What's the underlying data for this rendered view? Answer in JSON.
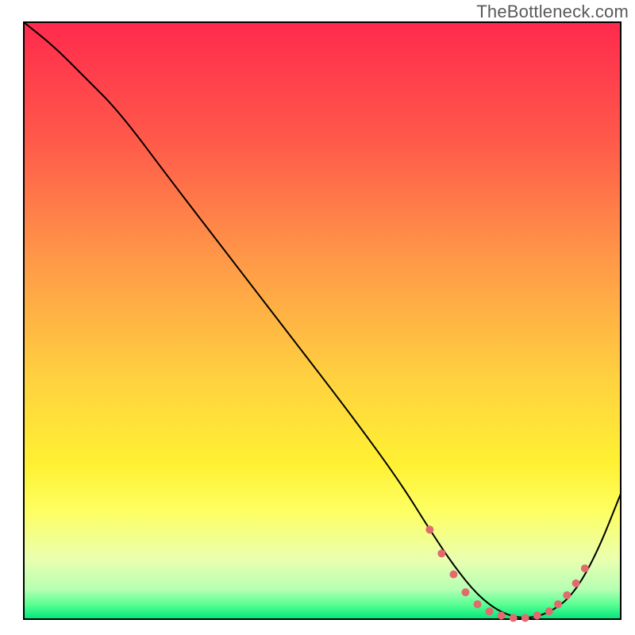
{
  "watermark": "TheBottleneck.com",
  "chart_data": {
    "type": "line",
    "title": "",
    "xlabel": "",
    "ylabel": "",
    "xlim": [
      0,
      100
    ],
    "ylim": [
      0,
      100
    ],
    "grid": false,
    "legend": false,
    "background": {
      "type": "vertical-gradient",
      "stops": [
        {
          "pos": 0.0,
          "color": "#ff2a4d"
        },
        {
          "pos": 0.2,
          "color": "#ff5a4a"
        },
        {
          "pos": 0.4,
          "color": "#ff9948"
        },
        {
          "pos": 0.6,
          "color": "#ffd23f"
        },
        {
          "pos": 0.74,
          "color": "#fff133"
        },
        {
          "pos": 0.82,
          "color": "#fdff62"
        },
        {
          "pos": 0.9,
          "color": "#eaffb0"
        },
        {
          "pos": 0.95,
          "color": "#b6ffb3"
        },
        {
          "pos": 0.975,
          "color": "#5cff93"
        },
        {
          "pos": 1.0,
          "color": "#00e67c"
        }
      ]
    },
    "series": [
      {
        "name": "bottleneck-curve",
        "color": "#000000",
        "stroke_width": 2,
        "x": [
          0,
          5,
          10,
          16,
          25,
          35,
          45,
          55,
          63,
          68,
          72,
          76,
          80,
          84,
          88,
          92,
          96,
          100
        ],
        "values": [
          100,
          96,
          91,
          85,
          73,
          60,
          47,
          34,
          23,
          15,
          9,
          4,
          1,
          0,
          1,
          4,
          11,
          21
        ]
      }
    ],
    "annotations": [
      {
        "name": "highlight-dots",
        "type": "dotted-segment",
        "color": "#e16a6f",
        "radius": 5,
        "points": [
          {
            "x": 68.0,
            "y": 15.0
          },
          {
            "x": 70.0,
            "y": 11.0
          },
          {
            "x": 72.0,
            "y": 7.5
          },
          {
            "x": 74.0,
            "y": 4.5
          },
          {
            "x": 76.0,
            "y": 2.5
          },
          {
            "x": 78.0,
            "y": 1.3
          },
          {
            "x": 80.0,
            "y": 0.6
          },
          {
            "x": 82.0,
            "y": 0.2
          },
          {
            "x": 84.0,
            "y": 0.2
          },
          {
            "x": 86.0,
            "y": 0.6
          },
          {
            "x": 88.0,
            "y": 1.3
          },
          {
            "x": 89.5,
            "y": 2.5
          },
          {
            "x": 91.0,
            "y": 4.0
          },
          {
            "x": 92.5,
            "y": 6.0
          },
          {
            "x": 94.0,
            "y": 8.5
          }
        ]
      }
    ]
  }
}
